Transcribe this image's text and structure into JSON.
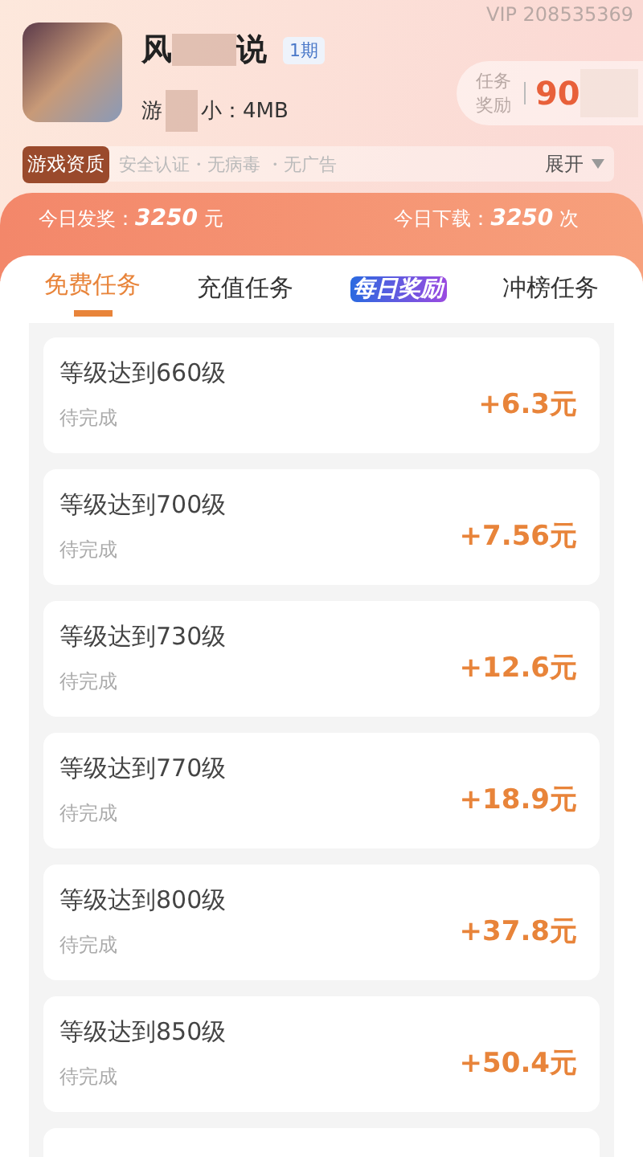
{
  "vip": "VIP 208535369",
  "game": {
    "title_start": "风",
    "title_end": "说",
    "period": "1期",
    "size_start": "游",
    "size_end": "小：4MB"
  },
  "reward": {
    "label": "任务奖励",
    "value": "90"
  },
  "qualification": {
    "label": "游戏资质",
    "features": "安全认证・无病毒 ・无广告",
    "expand": "展开"
  },
  "stats": [
    {
      "label": "今日发奖：",
      "value": "3250",
      "unit": "元"
    },
    {
      "label": "今日下载：",
      "value": "3250",
      "unit": "次"
    }
  ],
  "tabs": [
    {
      "label": "免费任务",
      "kind": "text",
      "selected": true
    },
    {
      "label": "充值任务",
      "kind": "text",
      "selected": false
    },
    {
      "label": "每日奖励",
      "kind": "badge",
      "selected": false
    },
    {
      "label": "冲榜任务",
      "kind": "text",
      "selected": false
    }
  ],
  "tasks": [
    {
      "title": "等级达到660级",
      "status": "待完成",
      "reward": "+6.3元"
    },
    {
      "title": "等级达到700级",
      "status": "待完成",
      "reward": "+7.56元"
    },
    {
      "title": "等级达到730级",
      "status": "待完成",
      "reward": "+12.6元"
    },
    {
      "title": "等级达到770级",
      "status": "待完成",
      "reward": "+18.9元"
    },
    {
      "title": "等级达到800级",
      "status": "待完成",
      "reward": "+37.8元"
    },
    {
      "title": "等级达到850级",
      "status": "待完成",
      "reward": "+50.4元"
    }
  ]
}
